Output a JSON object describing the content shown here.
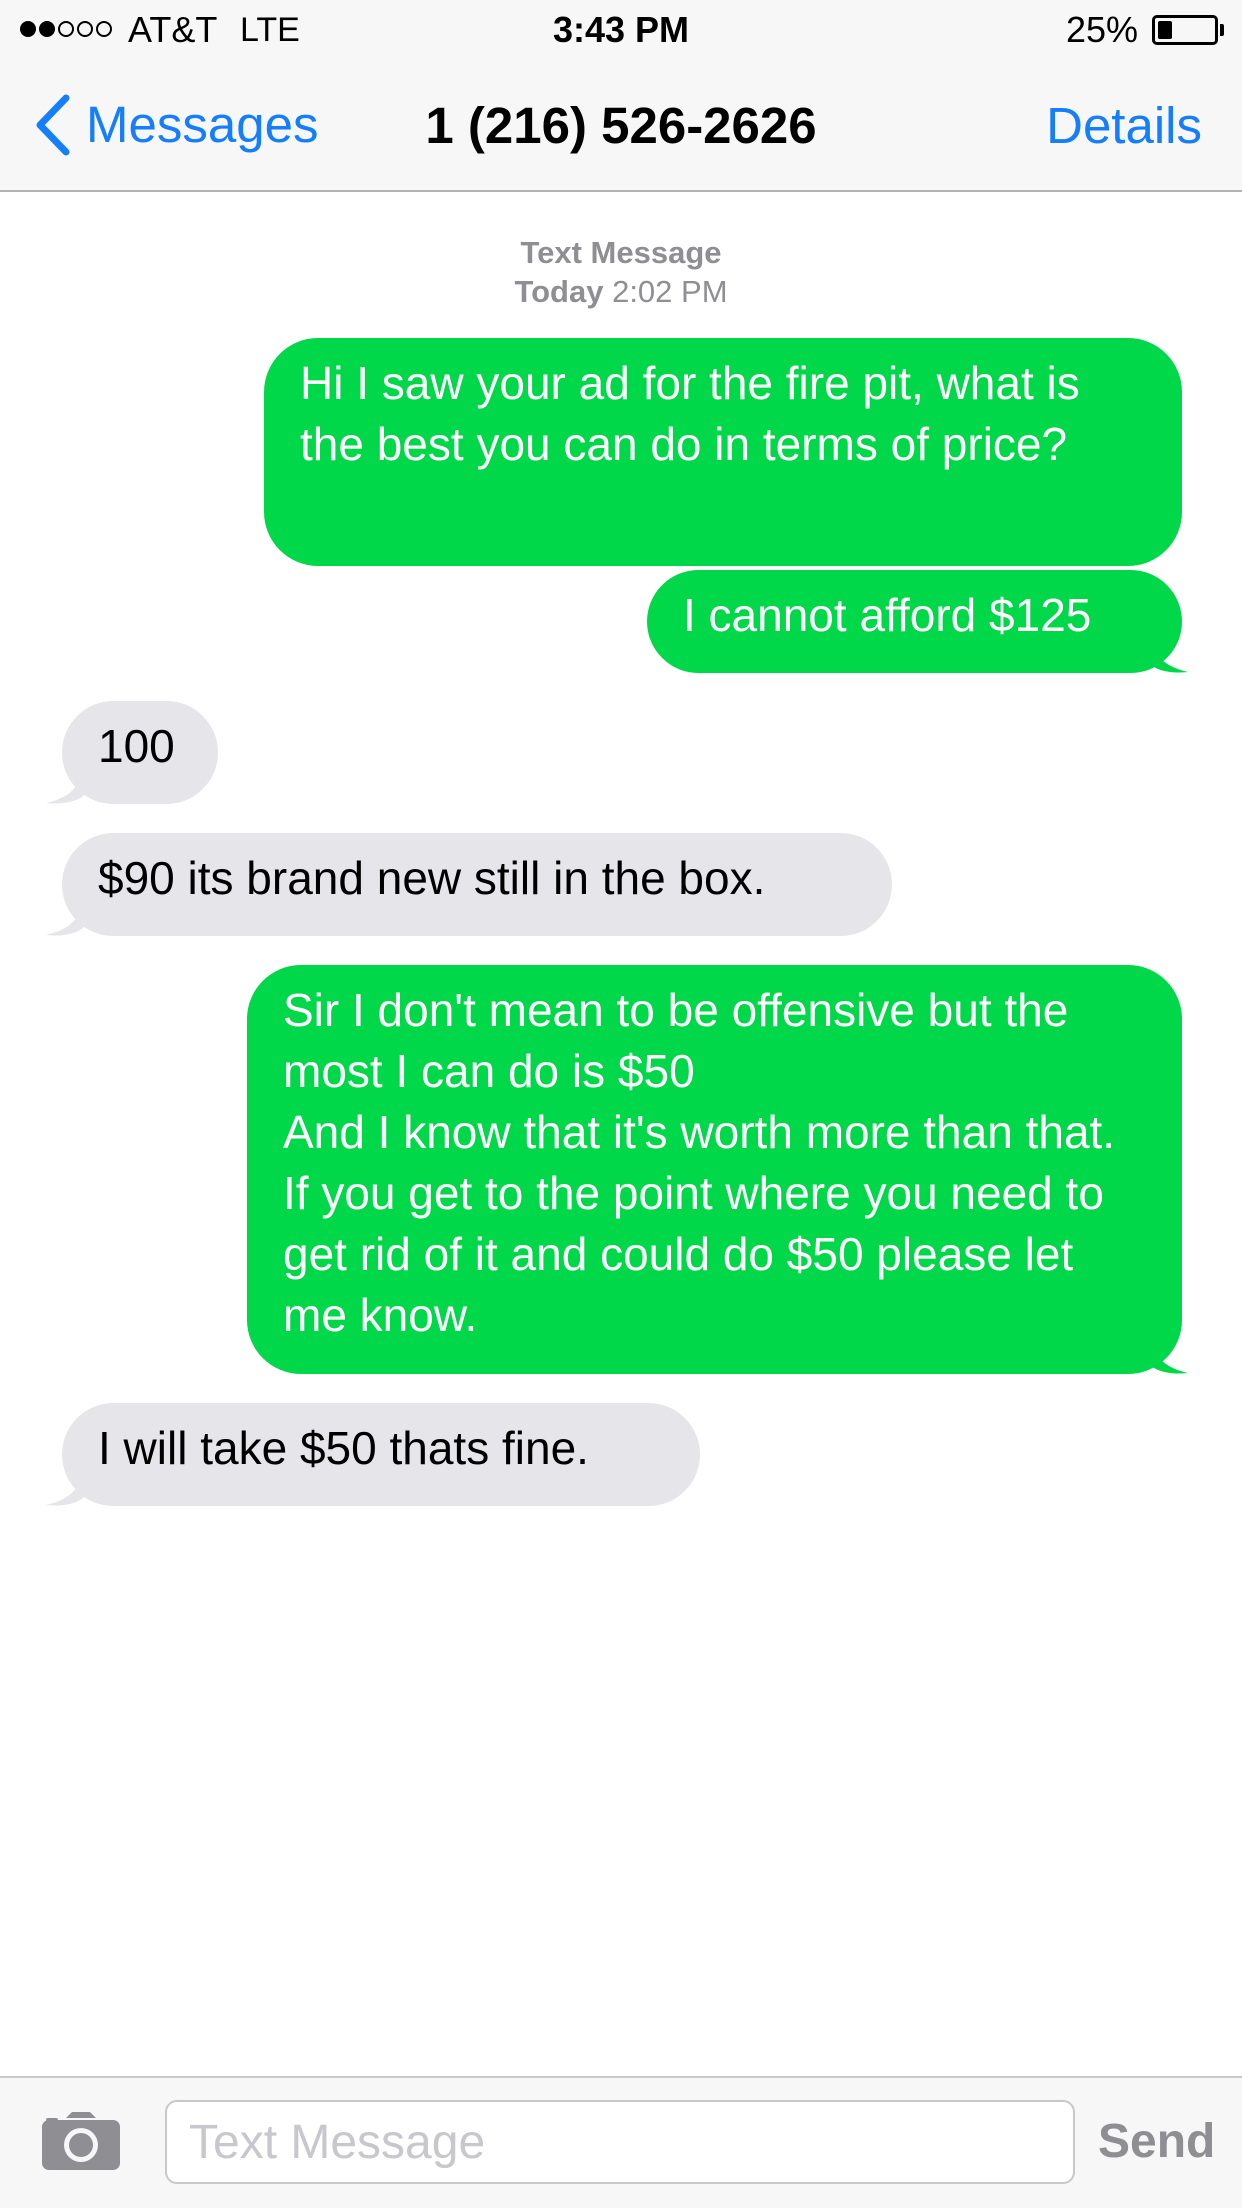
{
  "status_bar": {
    "signal_strength": 2,
    "signal_max": 5,
    "carrier": "AT&T",
    "network": "LTE",
    "time": "3:43 PM",
    "battery_percent_label": "25%",
    "battery_level": 0.25
  },
  "nav": {
    "back_label": "Messages",
    "title": "1 (216) 526-2626",
    "details_label": "Details"
  },
  "conversation": {
    "header_type": "Text Message",
    "header_day": "Today",
    "header_time": "2:02 PM",
    "messages": [
      {
        "direction": "sent",
        "text": "Hi I saw your ad for the fire pit, what is the best you can do in terms of price?"
      },
      {
        "direction": "sent",
        "text": "I cannot afford $125"
      },
      {
        "direction": "received",
        "text": "100"
      },
      {
        "direction": "received",
        "text": "$90 its brand new still in the box."
      },
      {
        "direction": "sent",
        "text": "Sir I don't mean to be offensive but the most I can do is $50\nAnd I know that it's worth more than that. If you get to the point where you need to get rid of it and could do $50 please let me know."
      },
      {
        "direction": "received",
        "text": "I will take $50 thats fine."
      }
    ]
  },
  "input": {
    "placeholder": "Text Message",
    "value": "",
    "send_label": "Send"
  },
  "colors": {
    "accent_blue": "#157efb",
    "sent_bubble": "#00d84a",
    "received_bubble": "#e5e5ea",
    "timestamp_gray": "#8e8e93"
  },
  "icons": {
    "back": "chevron-left-icon",
    "camera": "camera-icon"
  }
}
